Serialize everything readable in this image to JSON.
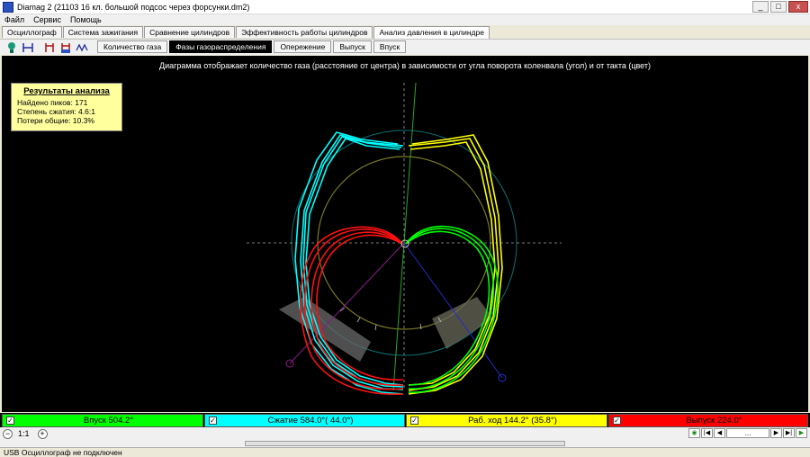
{
  "window": {
    "title": "Diamag 2 (21103 16 кл. большой подсос через форсунки.dm2)",
    "buttons": [
      "_",
      "□",
      "x"
    ]
  },
  "menu": [
    "Файл",
    "Сервис",
    "Помощь"
  ],
  "main_tabs": [
    "Осциллограф",
    "Система зажигания",
    "Сравнение цилиндров",
    "Эффективность работы цилиндров",
    "Анализ давления в цилиндре"
  ],
  "sub_tabs": [
    "Количество газа",
    "Фазы газораспределения",
    "Опережение",
    "Выпуск",
    "Впуск"
  ],
  "caption": "Диаграмма отображает количество газа (расстояние от центра) в зависимости от угла поворота коленвала (угол) и от такта (цвет)",
  "results": {
    "title": "Результаты анализа",
    "peaks": "Найдено пиков: 171",
    "compression": "Степень сжатия: 4.6:1",
    "losses": "Потери общие: 10.3%"
  },
  "phases": [
    {
      "label": "Впуск 504.2°",
      "color": "#00ff00"
    },
    {
      "label": "Сжатие 584.0°( 44.0°)",
      "color": "#00ffff"
    },
    {
      "label": "Раб. ход 144.2° (35.8°)",
      "color": "#ffff00"
    },
    {
      "label": "Выпуск 224.0°",
      "color": "#ff0000"
    }
  ],
  "zoom": {
    "minus": "−",
    "plus": "+",
    "label": "1:1"
  },
  "nav": {
    "field": "...",
    "buttons": [
      "◉",
      "|◀",
      "◀",
      "▶",
      "▶|",
      "▶"
    ]
  },
  "status": "USB Осциллограф не подключен"
}
